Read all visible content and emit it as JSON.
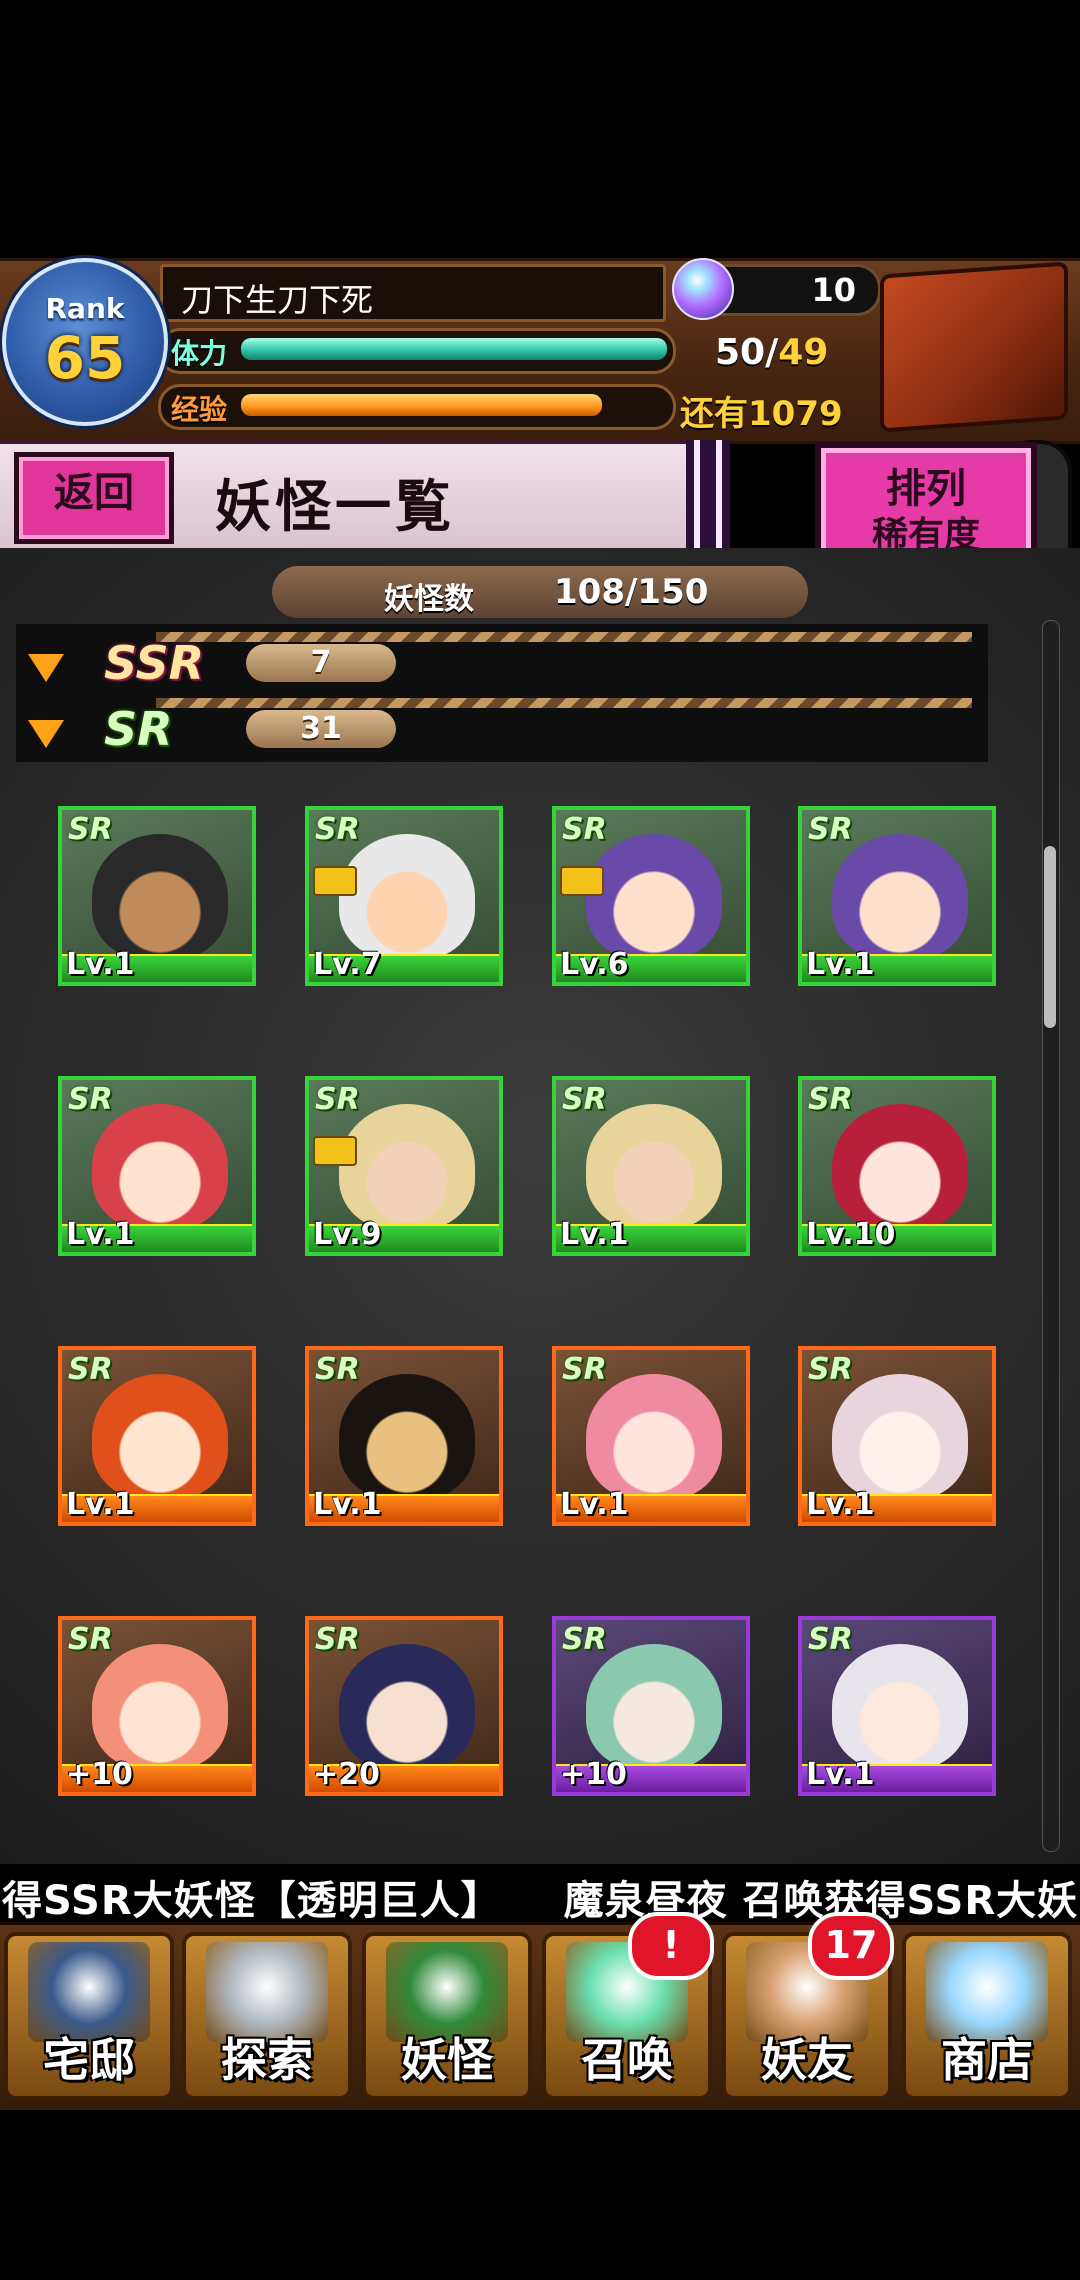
{
  "player": {
    "rank_label": "Rank",
    "rank_value": "65",
    "name": "刀下生刀下死",
    "gems": "10",
    "stamina_label": "体力",
    "stamina_current": "50",
    "stamina_sep": "/",
    "stamina_max": "49",
    "stamina_fill": 1.0,
    "exp_label": "经验",
    "exp_remaining": "还有1079",
    "exp_fill": 0.86
  },
  "header": {
    "back_label": "返回",
    "title": "妖怪一覧",
    "sort_line1": "排列",
    "sort_line2": "稀有度"
  },
  "collection": {
    "count_label": "妖怪数",
    "count_value": "108/150"
  },
  "rarity_groups": [
    {
      "badge": "SSR",
      "count": "7"
    },
    {
      "badge": "SR",
      "count": "31"
    }
  ],
  "cards": [
    {
      "badge": "SR",
      "level": "Lv.1",
      "frame": "green",
      "locked": false,
      "skin": "#c08a5a",
      "hair": "#2a2a2a"
    },
    {
      "badge": "SR",
      "level": "Lv.7",
      "frame": "green",
      "locked": true,
      "skin": "#ffd3b0",
      "hair": "#e8e8e8"
    },
    {
      "badge": "SR",
      "level": "Lv.6",
      "frame": "green",
      "locked": true,
      "skin": "#ffe0cc",
      "hair": "#6a4aa8"
    },
    {
      "badge": "SR",
      "level": "Lv.1",
      "frame": "green",
      "locked": false,
      "skin": "#ffe0cc",
      "hair": "#6a4aa8"
    },
    {
      "badge": "SR",
      "level": "Lv.1",
      "frame": "green",
      "locked": false,
      "skin": "#ffe2d0",
      "hair": "#d8404a"
    },
    {
      "badge": "SR",
      "level": "Lv.9",
      "frame": "green",
      "locked": true,
      "skin": "#f3d0b8",
      "hair": "#e8d49a"
    },
    {
      "badge": "SR",
      "level": "Lv.1",
      "frame": "green",
      "locked": false,
      "skin": "#f3d0b8",
      "hair": "#e8d49a"
    },
    {
      "badge": "SR",
      "level": "Lv.10",
      "frame": "green",
      "locked": false,
      "skin": "#ffe4dc",
      "hair": "#b8203a"
    },
    {
      "badge": "SR",
      "level": "Lv.1",
      "frame": "orange",
      "locked": false,
      "skin": "#ffe4d0",
      "hair": "#e0501a"
    },
    {
      "badge": "SR",
      "level": "Lv.1",
      "frame": "orange",
      "locked": false,
      "skin": "#e8c080",
      "hair": "#1a1410"
    },
    {
      "badge": "SR",
      "level": "Lv.1",
      "frame": "orange",
      "locked": false,
      "skin": "#ffe4dc",
      "hair": "#f08aa0"
    },
    {
      "badge": "SR",
      "level": "Lv.1",
      "frame": "orange",
      "locked": false,
      "skin": "#fff0ec",
      "hair": "#e8d4dc"
    },
    {
      "badge": "SR",
      "level": "+10",
      "frame": "orange",
      "locked": false,
      "skin": "#ffe4d4",
      "hair": "#f4907a"
    },
    {
      "badge": "SR",
      "level": "+20",
      "frame": "orange",
      "locked": false,
      "skin": "#f8e0d0",
      "hair": "#2a2a5a"
    },
    {
      "badge": "SR",
      "level": "+10",
      "frame": "purple",
      "locked": false,
      "skin": "#f4e8e0",
      "hair": "#8ac8b0"
    },
    {
      "badge": "SR",
      "level": "Lv.1",
      "frame": "purple",
      "locked": false,
      "skin": "#ffe8dc",
      "hair": "#e8e4ec"
    }
  ],
  "ticker": {
    "text": "得SSR大妖怪【透明巨人】　　魔泉昼夜 召唤获得SSR大妖"
  },
  "nav": [
    {
      "label": "宅邸",
      "icon": "mansion-icon",
      "badge": "",
      "color": "#3a5a8a"
    },
    {
      "label": "探索",
      "icon": "magnifier-icon",
      "badge": "",
      "color": "#b0b8c0"
    },
    {
      "label": "妖怪",
      "icon": "scroll-icon",
      "badge": "",
      "color": "#2f8a3a"
    },
    {
      "label": "召唤",
      "icon": "pentagram-icon",
      "badge": "!",
      "color": "#6ae0b0"
    },
    {
      "label": "妖友",
      "icon": "friend-icon",
      "badge": "17",
      "color": "#d8a070"
    },
    {
      "label": "商店",
      "icon": "crystal-ball-icon",
      "badge": "",
      "color": "#9ad8ff"
    }
  ]
}
